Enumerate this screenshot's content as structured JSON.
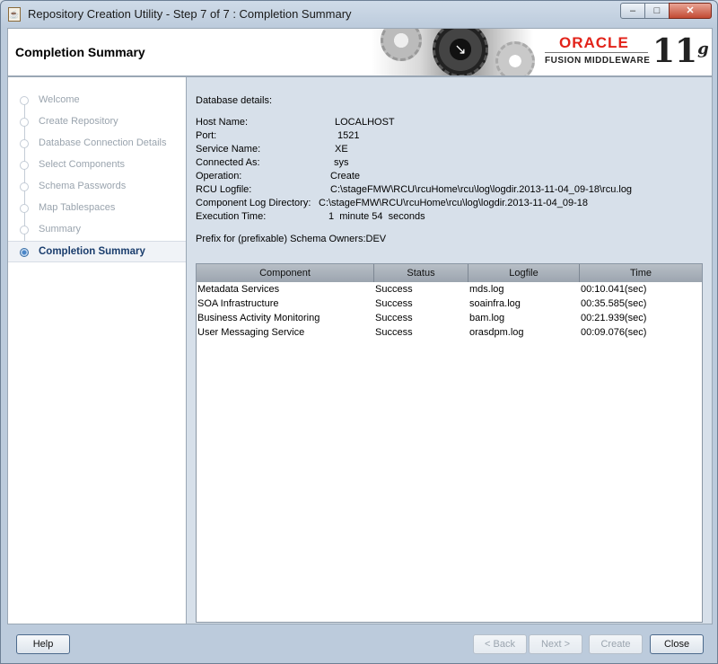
{
  "window": {
    "title": "Repository Creation Utility - Step 7 of 7 : Completion Summary",
    "controls": {
      "minimize": "–",
      "maximize": "□",
      "close": "✕"
    }
  },
  "header": {
    "title": "Completion Summary",
    "brand": "ORACLE",
    "product": "FUSION MIDDLEWARE",
    "version": "11",
    "version_suffix": "g",
    "brand_color": "#e2231a"
  },
  "sidebar": {
    "items": [
      {
        "label": "Welcome",
        "state": "done"
      },
      {
        "label": "Create Repository",
        "state": "done"
      },
      {
        "label": "Database Connection Details",
        "state": "done"
      },
      {
        "label": "Select Components",
        "state": "done"
      },
      {
        "label": "Schema Passwords",
        "state": "done"
      },
      {
        "label": "Map Tablespaces",
        "state": "done"
      },
      {
        "label": "Summary",
        "state": "done"
      },
      {
        "label": "Completion Summary",
        "state": "active"
      }
    ]
  },
  "details": {
    "heading": "Database details:",
    "rows": [
      {
        "label": "Host Name:",
        "value": "LOCALHOST"
      },
      {
        "label": "Port:",
        "value": "1521"
      },
      {
        "label": "Service Name:",
        "value": "XE"
      },
      {
        "label": "Connected As:",
        "value": "sys"
      },
      {
        "label": "Operation:",
        "value": "Create"
      },
      {
        "label": "RCU Logfile:",
        "value": "C:\\stageFMW\\RCU\\rcuHome\\rcu\\log\\logdir.2013-11-04_09-18\\rcu.log"
      },
      {
        "label": "Component Log Directory:",
        "value": "C:\\stageFMW\\RCU\\rcuHome\\rcu\\log\\logdir.2013-11-04_09-18"
      },
      {
        "label": "Execution Time:",
        "value": "1  minute 54  seconds"
      }
    ],
    "prefix": "Prefix for (prefixable) Schema Owners:DEV"
  },
  "table": {
    "headers": [
      "Component",
      "Status",
      "Logfile",
      "Time"
    ],
    "rows": [
      [
        "Metadata Services",
        "Success",
        "mds.log",
        "00:10.041(sec)"
      ],
      [
        "SOA Infrastructure",
        "Success",
        "soainfra.log",
        "00:35.585(sec)"
      ],
      [
        "Business Activity Monitoring",
        "Success",
        "bam.log",
        "00:21.939(sec)"
      ],
      [
        "User Messaging Service",
        "Success",
        "orasdpm.log",
        "00:09.076(sec)"
      ]
    ]
  },
  "footer": {
    "help": "Help",
    "back": "< Back",
    "next": "Next >",
    "create": "Create",
    "close": "Close"
  }
}
